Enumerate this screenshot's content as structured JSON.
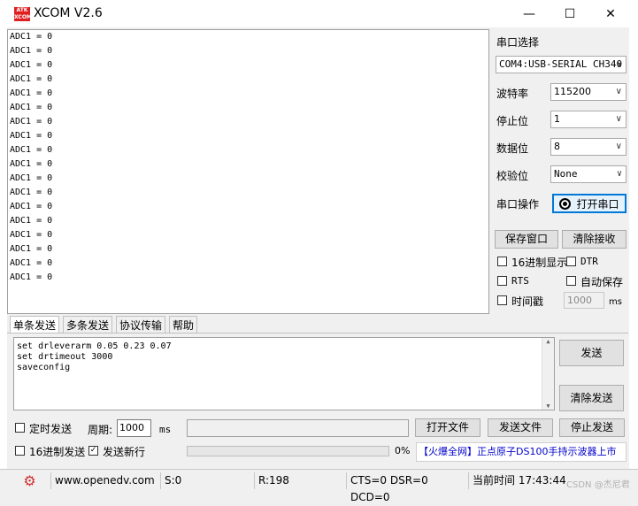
{
  "window": {
    "title": "XCOM V2.6",
    "logo_text": "ATK XCOM",
    "minimize": "—",
    "maximize": "☐",
    "close": "✕"
  },
  "output": {
    "lines": [
      "ADC1 = 0",
      "ADC1 = 0",
      "ADC1 = 0",
      "ADC1 = 0",
      "ADC1 = 0",
      "ADC1 = 0",
      "ADC1 = 0",
      "ADC1 = 0",
      "ADC1 = 0",
      "ADC1 = 0",
      "ADC1 = 0",
      "ADC1 = 0",
      "ADC1 = 0",
      "ADC1 = 0",
      "ADC1 = 0",
      "ADC1 = 0",
      "ADC1 = 0",
      "ADC1 = 0"
    ]
  },
  "serial": {
    "port_label": "串口选择",
    "port_value": "COM4:USB-SERIAL CH340",
    "baud_label": "波特率",
    "baud_value": "115200",
    "stop_label": "停止位",
    "stop_value": "1",
    "data_label": "数据位",
    "data_value": "8",
    "parity_label": "校验位",
    "parity_value": "None",
    "op_label": "串口操作",
    "open_button": "打开串口"
  },
  "receive": {
    "save_button": "保存窗口",
    "clear_button": "清除接收",
    "hex_display": "16进制显示",
    "dtr": "DTR",
    "rts": "RTS",
    "auto_save": "自动保存",
    "timestamp": "时间戳",
    "timestamp_value": "1000",
    "ms": "ms"
  },
  "tabs": [
    "单条发送",
    "多条发送",
    "协议传输",
    "帮助"
  ],
  "send": {
    "lines": [
      "set drleverarm 0.05 0.23 0.07",
      "set drtimeout 3000",
      "saveconfig"
    ],
    "send_button": "发送",
    "clear_send_button": "清除发送",
    "timed_send": "定时发送",
    "period_label": "周期:",
    "period_value": "1000",
    "period_unit": "ms",
    "open_file": "打开文件",
    "send_file": "发送文件",
    "stop_send": "停止发送",
    "hex_send": "16进制发送",
    "send_newline": "发送新行",
    "send_newline_checked": true,
    "progress": "0%",
    "ad_text": "【火爆全网】正点原子DS100手持示波器上市"
  },
  "status": {
    "url": "www.openedv.com",
    "sent": "S:0",
    "recv": "R:198",
    "lines": "CTS=0 DSR=0 DCD=0",
    "time": "当前时间 17:43:44",
    "watermark": "CSDN @杰尼君"
  }
}
